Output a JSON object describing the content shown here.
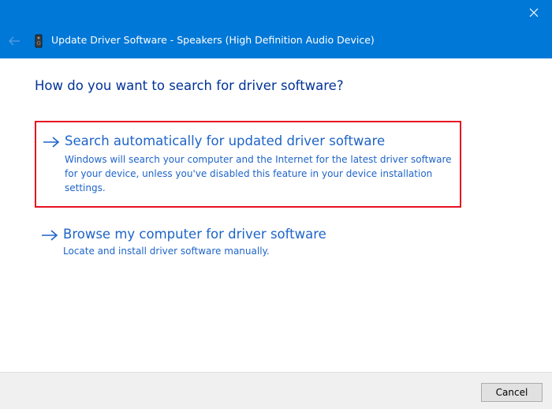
{
  "window": {
    "title": "Update Driver Software - Speakers (High Definition Audio Device)",
    "accent_color": "#0078d7"
  },
  "titlebar": {
    "close_icon": "close-icon",
    "back_icon": "back-arrow-icon",
    "device_icon": "speaker-device-icon"
  },
  "main": {
    "heading": "How do you want to search for driver software?",
    "options": [
      {
        "title": "Search automatically for updated driver software",
        "description": "Windows will search your computer and the Internet for the latest driver software for your device, unless you've disabled this feature in your device installation settings.",
        "icon": "arrow-right-icon",
        "highlighted": true
      },
      {
        "title": "Browse my computer for driver software",
        "description": "Locate and install driver software manually.",
        "icon": "arrow-right-icon",
        "highlighted": false
      }
    ],
    "highlight_color": "#e81123",
    "link_color": "#1e64c8"
  },
  "footer": {
    "cancel_label": "Cancel"
  }
}
